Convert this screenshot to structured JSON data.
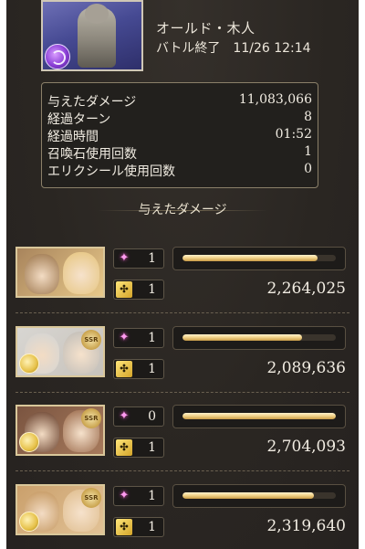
{
  "header": {
    "boss_name": "オールド・木人",
    "status": "バトル終了",
    "timestamp": "11/26 12:14",
    "boss_element_icon": "dark-element-icon"
  },
  "stats": [
    {
      "label": "与えたダメージ",
      "value": "11,083,066"
    },
    {
      "label": "経過ターン",
      "value": "8"
    },
    {
      "label": "経過時間",
      "value": "01:52"
    },
    {
      "label": "召喚石使用回数",
      "value": "1"
    },
    {
      "label": "エリクシール使用回数",
      "value": "0"
    }
  ],
  "section_title": "与えたダメージ",
  "characters": [
    {
      "summon_count": "1",
      "elixir_count": "1",
      "damage": "2,264,025",
      "bar_ratio": 0.88,
      "badge": "",
      "colors": [
        "#a8845c",
        "#e8c98a"
      ]
    },
    {
      "summon_count": "1",
      "elixir_count": "1",
      "damage": "2,089,636",
      "bar_ratio": 0.78,
      "badge": "SSR",
      "colors": [
        "#d8d6d2",
        "#c7c2bb"
      ]
    },
    {
      "summon_count": "0",
      "elixir_count": "1",
      "damage": "2,704,093",
      "bar_ratio": 1.0,
      "badge": "SSR",
      "colors": [
        "#7a5440",
        "#a77a5c"
      ]
    },
    {
      "summon_count": "1",
      "elixir_count": "1",
      "damage": "2,319,640",
      "bar_ratio": 0.86,
      "badge": "SSR",
      "colors": [
        "#caa06c",
        "#e2c296"
      ]
    }
  ],
  "colors": {
    "summon_icon": "#ff9bf0",
    "elixir_icon": "#e6bf3c",
    "bar_fill": "#f3d58d",
    "panel_bg": "#2b2724"
  }
}
